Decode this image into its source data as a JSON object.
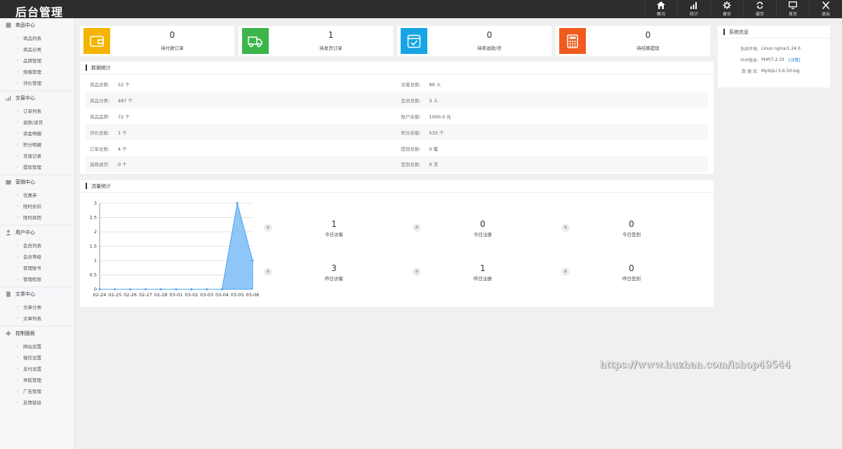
{
  "app": {
    "title": "后台管理"
  },
  "topnav": [
    {
      "label": "概况",
      "icon": "home-icon"
    },
    {
      "label": "统计",
      "icon": "bar-chart-icon"
    },
    {
      "label": "备份",
      "icon": "gear-icon"
    },
    {
      "label": "缓存",
      "icon": "refresh-icon"
    },
    {
      "label": "首页",
      "icon": "monitor-icon"
    },
    {
      "label": "退出",
      "icon": "close-icon"
    }
  ],
  "sidebar": [
    {
      "title": "商品中心",
      "icon": "box-icon",
      "items": [
        "商品列表",
        "商品分类",
        "品牌管理",
        "规格管理",
        "评价管理"
      ]
    },
    {
      "title": "交易中心",
      "icon": "bar-chart-icon",
      "items": [
        "订单列表",
        "退款/退货",
        "资金明细",
        "积分明细",
        "充值记录",
        "提现管理"
      ]
    },
    {
      "title": "营销中心",
      "icon": "gift-icon",
      "items": [
        "优惠券",
        "限时折扣",
        "限时拼团"
      ]
    },
    {
      "title": "用户中心",
      "icon": "user-icon",
      "items": [
        "会员列表",
        "会员等级",
        "管理账号",
        "管理权限"
      ]
    },
    {
      "title": "文章中心",
      "icon": "document-icon",
      "items": [
        "文章分类",
        "文章列表"
      ]
    },
    {
      "title": "控制面板",
      "icon": "gear-icon",
      "items": [
        "网站设置",
        "微信设置",
        "支付设置",
        "导航管理",
        "广告管理",
        "友情链接"
      ]
    }
  ],
  "stats": [
    {
      "value": "0",
      "label": "待付款订单",
      "color": "#f5b400",
      "icon": "wallet-icon"
    },
    {
      "value": "1",
      "label": "待发货订单",
      "color": "#3cb54a",
      "icon": "truck-icon"
    },
    {
      "value": "0",
      "label": "待审退款/货",
      "color": "#16a4e4",
      "icon": "check-box-icon"
    },
    {
      "value": "0",
      "label": "待结算提现",
      "color": "#f05a1e",
      "icon": "calculator-icon"
    }
  ],
  "data_stats": {
    "title": "数据统计",
    "rows": [
      [
        {
          "k": "商品总数:",
          "v": "52 个"
        },
        {
          "k": "访客总数:",
          "v": "99 人"
        }
      ],
      [
        {
          "k": "商品分类:",
          "v": "497 个"
        },
        {
          "k": "会员总数:",
          "v": "3 人"
        }
      ],
      [
        {
          "k": "商品品牌:",
          "v": "72 个"
        },
        {
          "k": "账户余额:",
          "v": "1000.0 元"
        }
      ],
      [
        {
          "k": "评价总数:",
          "v": "1 个"
        },
        {
          "k": "积分余额:",
          "v": "533 个"
        }
      ],
      [
        {
          "k": "订单总数:",
          "v": "4 个"
        },
        {
          "k": "提现总数:",
          "v": "0 笔"
        }
      ],
      [
        {
          "k": "退款退货:",
          "v": "0 个"
        },
        {
          "k": "签到总数:",
          "v": "0 次"
        }
      ]
    ]
  },
  "flow": {
    "title": "流量统计",
    "stats": [
      {
        "value": "1",
        "label": "今日访客"
      },
      {
        "value": "0",
        "label": "今日注册"
      },
      {
        "value": "0",
        "label": "今日签到"
      },
      {
        "value": "3",
        "label": "昨日访客"
      },
      {
        "value": "1",
        "label": "昨日注册"
      },
      {
        "value": "0",
        "label": "昨日签到"
      }
    ]
  },
  "system": {
    "title": "系统信息",
    "rows": [
      {
        "k": "系统环境:",
        "v": "Linux nginx/1.24.0"
      },
      {
        "k": "PHP版本:",
        "v": "PHP/7.2.33",
        "link": "[详情]"
      },
      {
        "k": "数 据 库:",
        "v": "MySQLi 5.6.50-log"
      }
    ]
  },
  "watermark": "https://www.huzhan.com/ishop49544",
  "chart_data": {
    "type": "area",
    "categories": [
      "02-24",
      "02-25",
      "02-26",
      "02-27",
      "02-28",
      "03-01",
      "03-02",
      "03-03",
      "03-04",
      "03-05",
      "03-06"
    ],
    "values": [
      0,
      0,
      0,
      0,
      0,
      0,
      0,
      0,
      0,
      3,
      1
    ],
    "ylim": [
      0,
      3
    ],
    "yticks": [
      "0",
      "0.5",
      "1",
      "1.5",
      "2",
      "2.5",
      "3"
    ],
    "color": "#6cb4f5",
    "grid": true
  }
}
